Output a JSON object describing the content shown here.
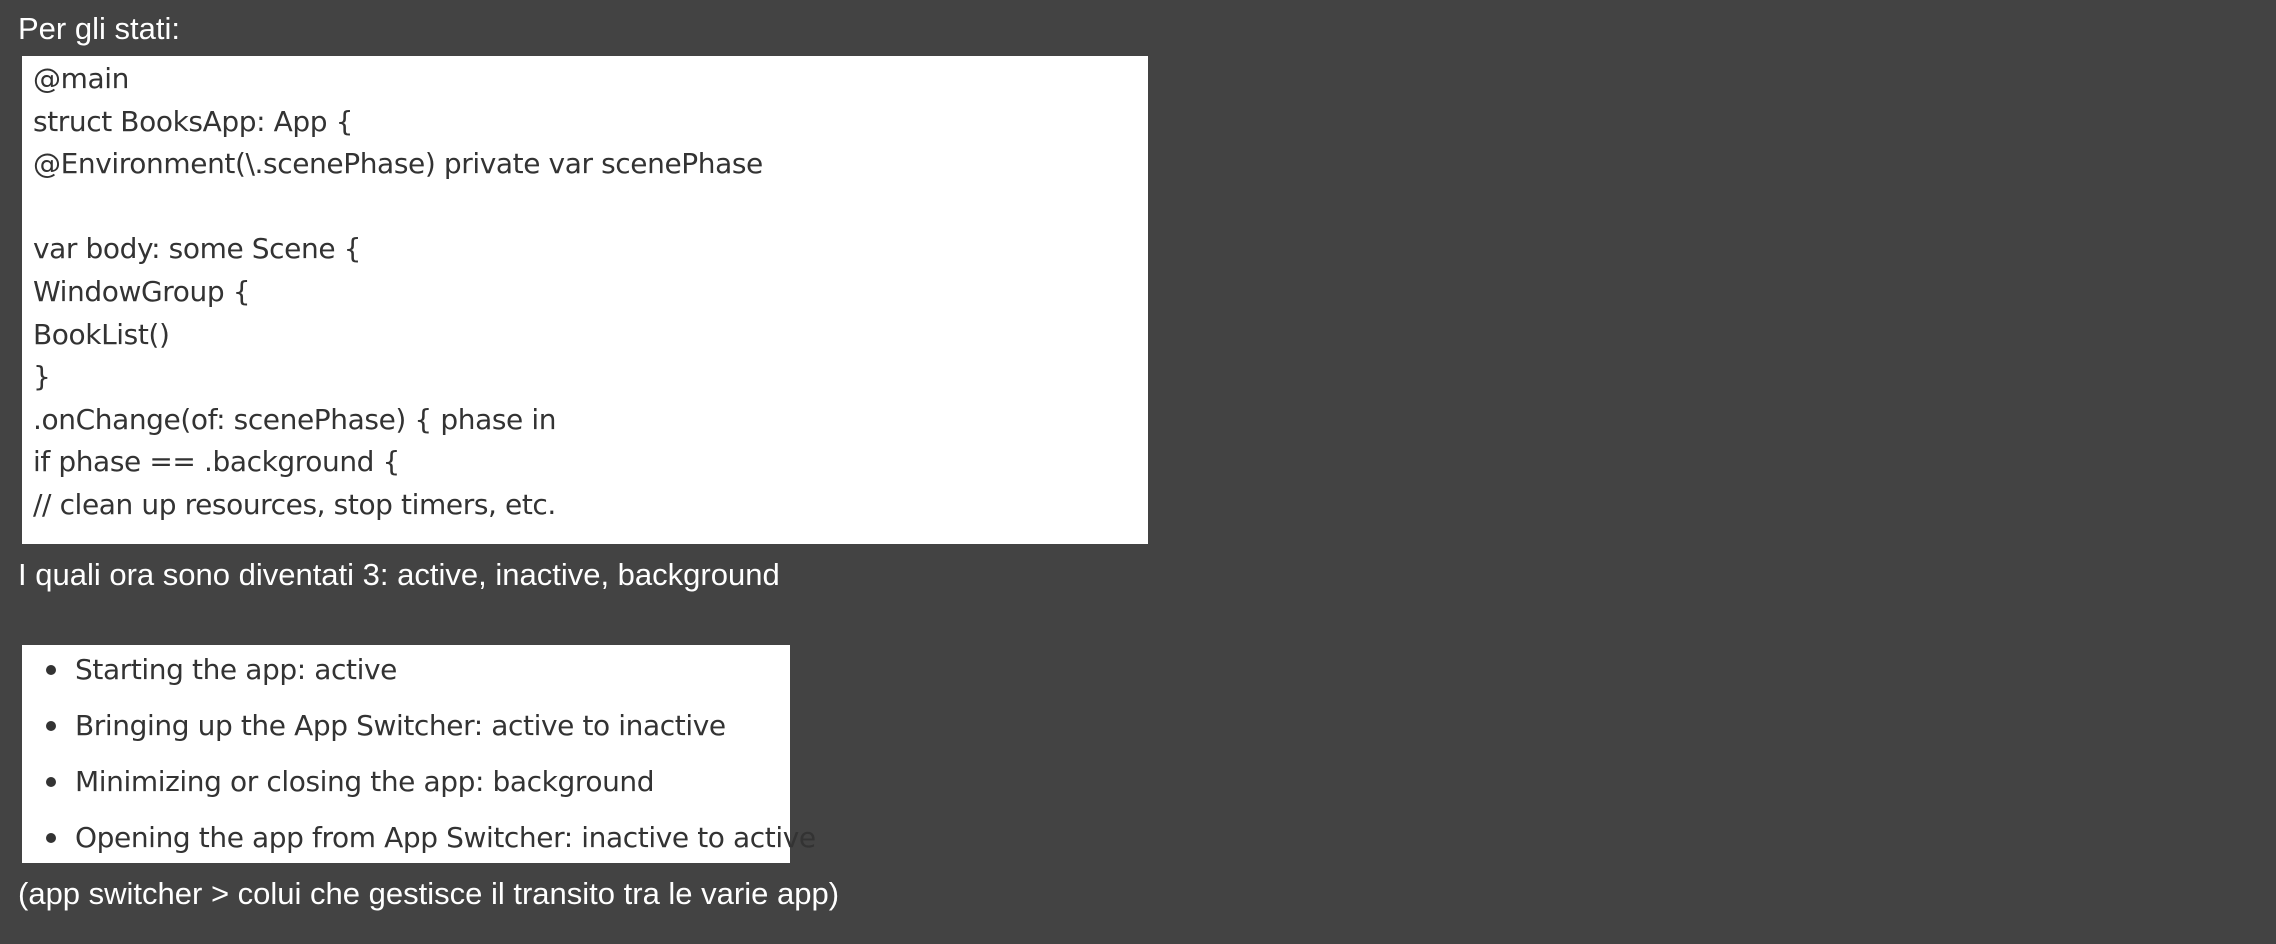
{
  "heading_states": "Per gli stati:",
  "code_lines": [
    "@main",
    "struct BooksApp: App {",
    "@Environment(\\.scenePhase) private var scenePhase",
    "",
    "var body: some Scene {",
    "WindowGroup {",
    "BookList()",
    "}",
    ".onChange(of: scenePhase) { phase in",
    "if phase == .background {",
    "// clean up resources, stop timers, etc."
  ],
  "heading_now": "I quali ora sono diventati 3: active, inactive, background",
  "list_items": [
    "Starting the app: active",
    "Bringing up the App Switcher: active to inactive",
    "Minimizing or closing the app: background",
    "Opening the app from App Switcher: inactive to active"
  ],
  "note": "(app switcher > colui che gestisce il transito tra le varie app)"
}
